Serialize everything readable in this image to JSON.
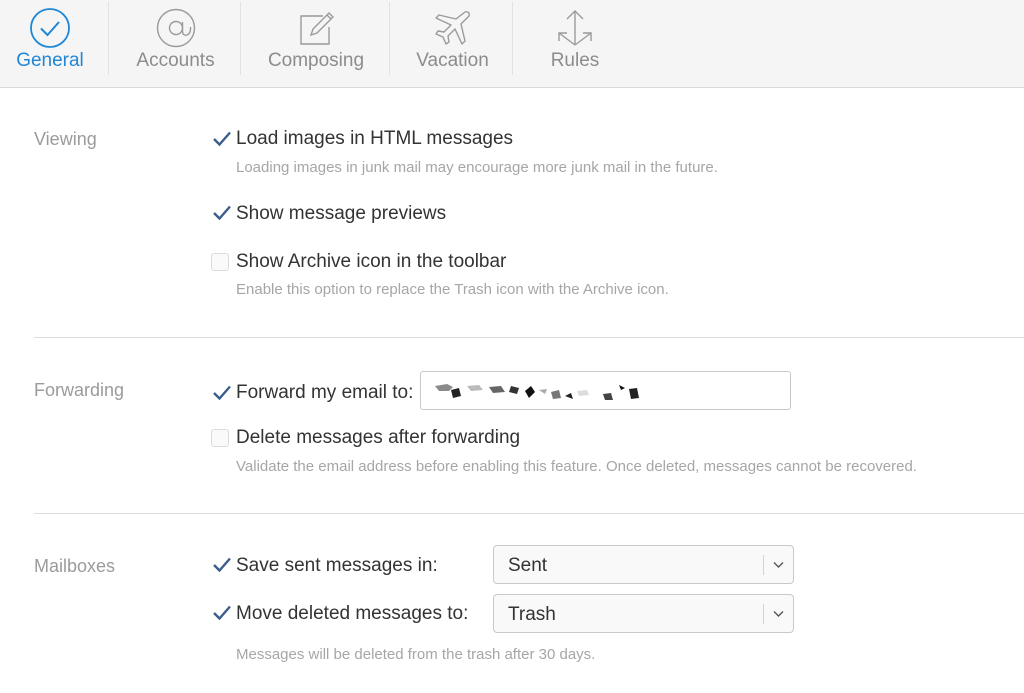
{
  "tabs": [
    {
      "label": "General",
      "icon": "checkmark-circle-icon",
      "active": true
    },
    {
      "label": "Accounts",
      "icon": "at-sign-icon",
      "active": false
    },
    {
      "label": "Composing",
      "icon": "compose-icon",
      "active": false
    },
    {
      "label": "Vacation",
      "icon": "airplane-icon",
      "active": false
    },
    {
      "label": "Rules",
      "icon": "arrows-icon",
      "active": false
    }
  ],
  "colors": {
    "accent": "#1f87d6",
    "checkmark": "#3a5e8c",
    "section_label": "#9b9b9b",
    "hint": "#a6a6a6"
  },
  "viewing": {
    "title": "Viewing",
    "load_images": {
      "label": "Load images in HTML messages",
      "checked": true,
      "hint": "Loading images in junk mail may encourage more junk mail in the future."
    },
    "show_previews": {
      "label": "Show message previews",
      "checked": true
    },
    "archive_icon": {
      "label": "Show Archive icon in the toolbar",
      "checked": false,
      "hint": "Enable this option to replace the Trash icon with the Archive icon."
    }
  },
  "forwarding": {
    "title": "Forwarding",
    "forward": {
      "label": "Forward my email to:",
      "checked": true
    },
    "delete_after": {
      "label": "Delete messages after forwarding",
      "checked": false,
      "hint": "Validate the email address before enabling this feature. Once deleted, messages cannot be recovered."
    }
  },
  "mailboxes": {
    "title": "Mailboxes",
    "save_sent": {
      "label": "Save sent messages in:",
      "checked": true,
      "value": "Sent"
    },
    "move_deleted": {
      "label": "Move deleted messages to:",
      "checked": true,
      "value": "Trash"
    },
    "hint": "Messages will be deleted from the trash after 30 days."
  }
}
